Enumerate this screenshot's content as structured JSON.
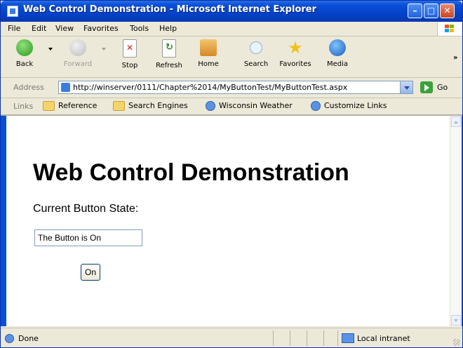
{
  "window": {
    "title": "Web Control Demonstration - Microsoft Internet Explorer"
  },
  "menu": [
    "File",
    "Edit",
    "View",
    "Favorites",
    "Tools",
    "Help"
  ],
  "toolbar": {
    "back": "Back",
    "forward": "Forward",
    "stop": "Stop",
    "refresh": "Refresh",
    "home": "Home",
    "search": "Search",
    "favorites": "Favorites",
    "media": "Media"
  },
  "address": {
    "label": "Address",
    "url": "http://winserver/0111/Chapter%2014/MyButtonTest/MyButtonTest.aspx",
    "go": "Go"
  },
  "links": {
    "label": "Links",
    "items": [
      "Reference",
      "Search Engines",
      "Wisconsin Weather",
      "Customize Links"
    ]
  },
  "page": {
    "heading": "Web Control Demonstration",
    "subheading": "Current Button State:",
    "state_value": "The Button is On",
    "button_label": "On"
  },
  "status": {
    "text": "Done",
    "zone": "Local intranet"
  },
  "colors": {
    "titlebar": "#0a4fd8",
    "chrome": "#ece9d8"
  }
}
